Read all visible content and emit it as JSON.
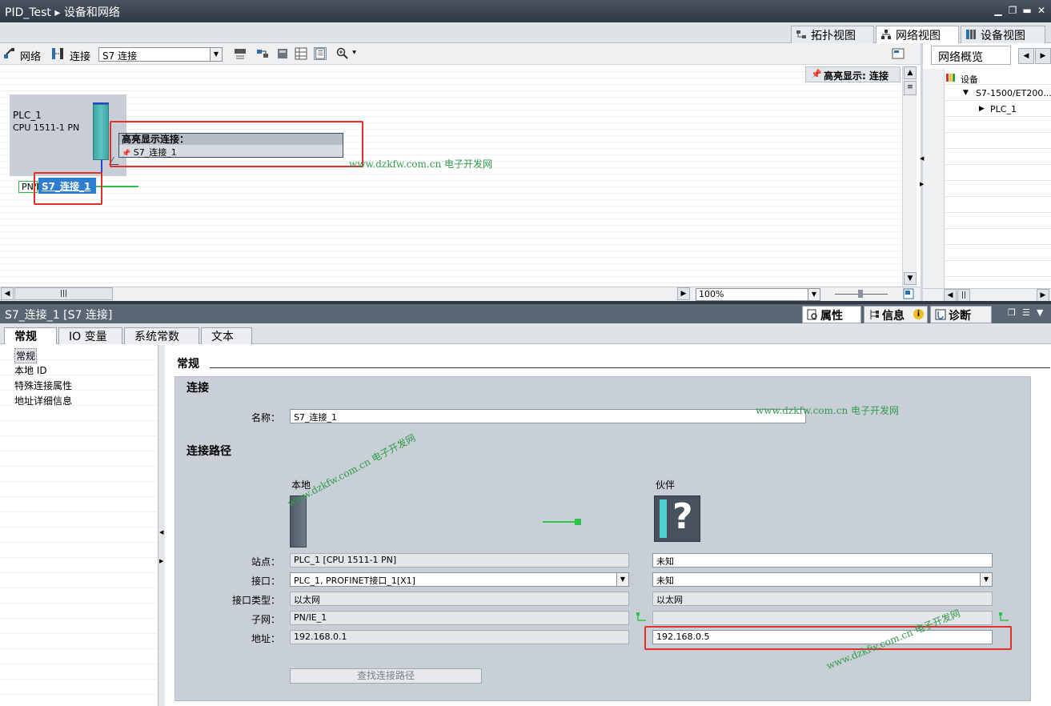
{
  "window": {
    "title": "PID_Test ▸ 设备和网络"
  },
  "view_tabs": [
    "拓扑视图",
    "网络视图",
    "设备视图"
  ],
  "toolbar": {
    "network_label": "网络",
    "connections_label": "连接",
    "connection_type": "S7 连接"
  },
  "canvas": {
    "highlight_badge": "高亮显示: 连接",
    "plc_name": "PLC_1",
    "plc_cpu": "CPU 1511-1 PN",
    "pn_label": "PN/I",
    "connection_chip": "S7_连接_1",
    "tooltip_title": "高亮显示连接：",
    "tooltip_item": "S7_连接_1",
    "zoom": "100%"
  },
  "watermark": "www.dzkfw.com.cn 电子开发网",
  "overview": {
    "tab": "网络概览",
    "rows": [
      "设备",
      "S7-1500/ET200...",
      "PLC_1"
    ]
  },
  "inspector": {
    "title": "S7_连接_1 [S7 连接]",
    "tabs": [
      "属性",
      "信息",
      "诊断"
    ]
  },
  "main_tabs": [
    "常规",
    "IO 变量",
    "系统常数",
    "文本"
  ],
  "nav_items": [
    "常规",
    "本地 ID",
    "特殊连接属性",
    "地址详细信息"
  ],
  "general": {
    "title": "常规",
    "section_connection": "连接",
    "name_label": "名称：",
    "name_value": "S7_连接_1",
    "section_path": "连接路径",
    "local_header": "本地",
    "partner_header": "伙伴",
    "labels": [
      "站点：",
      "接口：",
      "接口类型：",
      "子网：",
      "地址："
    ],
    "local": {
      "station": "PLC_1 [CPU 1511-1 PN]",
      "interface": "PLC_1, PROFINET接口_1[X1]",
      "interface_type": "以太网",
      "subnet": "PN/IE_1",
      "address": "192.168.0.1"
    },
    "partner": {
      "station": "未知",
      "interface": "未知",
      "interface_type": "以太网",
      "subnet": "",
      "address": "192.168.0.5"
    },
    "find_path_button": "查找连接路径"
  },
  "colors": {
    "accent_red": "#e0302a",
    "link_green": "#2cc44b",
    "selection_blue": "#2f7dd1"
  }
}
